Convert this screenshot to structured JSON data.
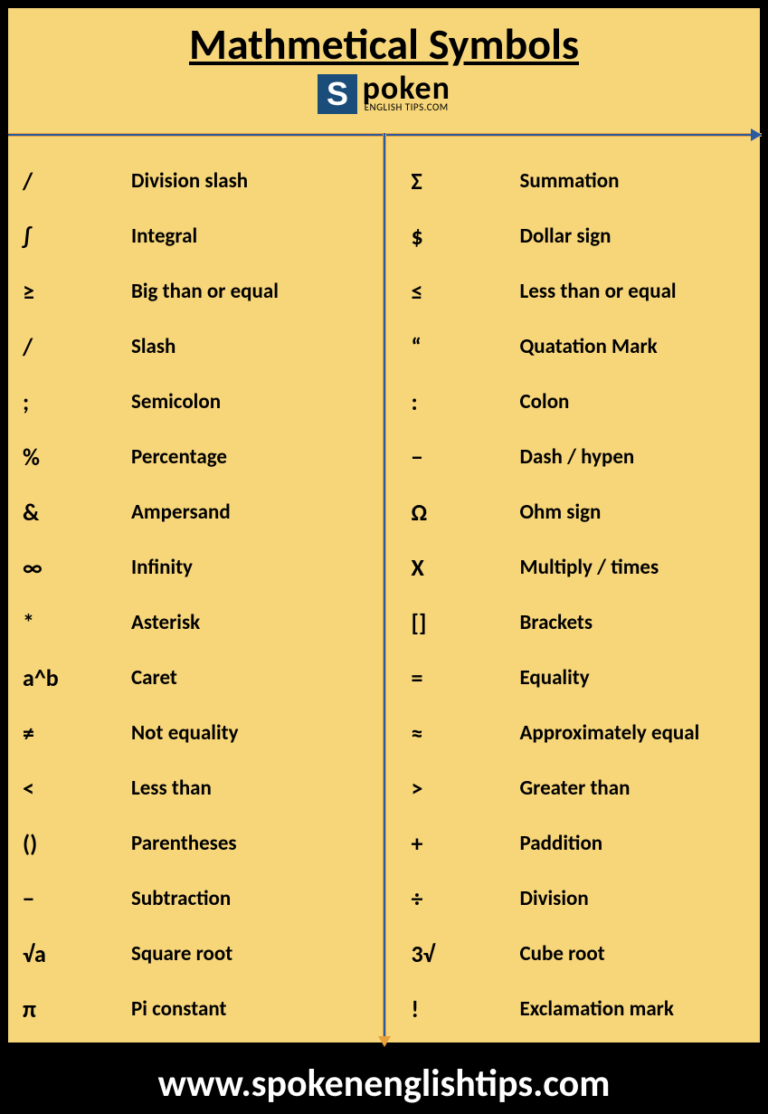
{
  "title": "Mathmetical Symbols",
  "logo": {
    "s": "S",
    "main": "poken",
    "sub": "ENGLISH TIPS.COM"
  },
  "left": [
    {
      "sym": "/",
      "name": "Division slash"
    },
    {
      "sym": "∫",
      "name": "Integral"
    },
    {
      "sym": "≥",
      "name": "Big than or equal"
    },
    {
      "sym": "/",
      "name": "Slash"
    },
    {
      "sym": ";",
      "name": "Semicolon"
    },
    {
      "sym": "%",
      "name": "Percentage"
    },
    {
      "sym": "&",
      "name": "Ampersand"
    },
    {
      "sym": "∞",
      "name": "Infinity"
    },
    {
      "sym": "*",
      "name": "Asterisk"
    },
    {
      "sym": "a^b",
      "name": "Caret"
    },
    {
      "sym": "≠",
      "name": "Not equality"
    },
    {
      "sym": "<",
      "name": "Less than"
    },
    {
      "sym": "()",
      "name": "Parentheses"
    },
    {
      "sym": "−",
      "name": "Subtraction"
    },
    {
      "sym": "√a",
      "name": "Square root"
    },
    {
      "sym": "π",
      "name": "Pi constant"
    }
  ],
  "right": [
    {
      "sym": "Σ",
      "name": "Summation"
    },
    {
      "sym": "$",
      "name": "Dollar sign"
    },
    {
      "sym": "≤",
      "name": "Less than or equal"
    },
    {
      "sym": "“",
      "name": "Quatation Mark"
    },
    {
      "sym": ":",
      "name": "Colon"
    },
    {
      "sym": "−",
      "name": "Dash / hypen"
    },
    {
      "sym": "Ω",
      "name": "Ohm sign"
    },
    {
      "sym": "X",
      "name": "Multiply / times"
    },
    {
      "sym": "[]",
      "name": "Brackets"
    },
    {
      "sym": "=",
      "name": "Equality"
    },
    {
      "sym": "≈",
      "name": "Approximately equal"
    },
    {
      "sym": ">",
      "name": "Greater than"
    },
    {
      "sym": "+",
      "name": "Paddition"
    },
    {
      "sym": "÷",
      "name": "Division"
    },
    {
      "sym": "3√",
      "name": "Cube root"
    },
    {
      "sym": "!",
      "name": "Exclamation mark"
    }
  ],
  "url": "www.spokenenglishtips.com"
}
